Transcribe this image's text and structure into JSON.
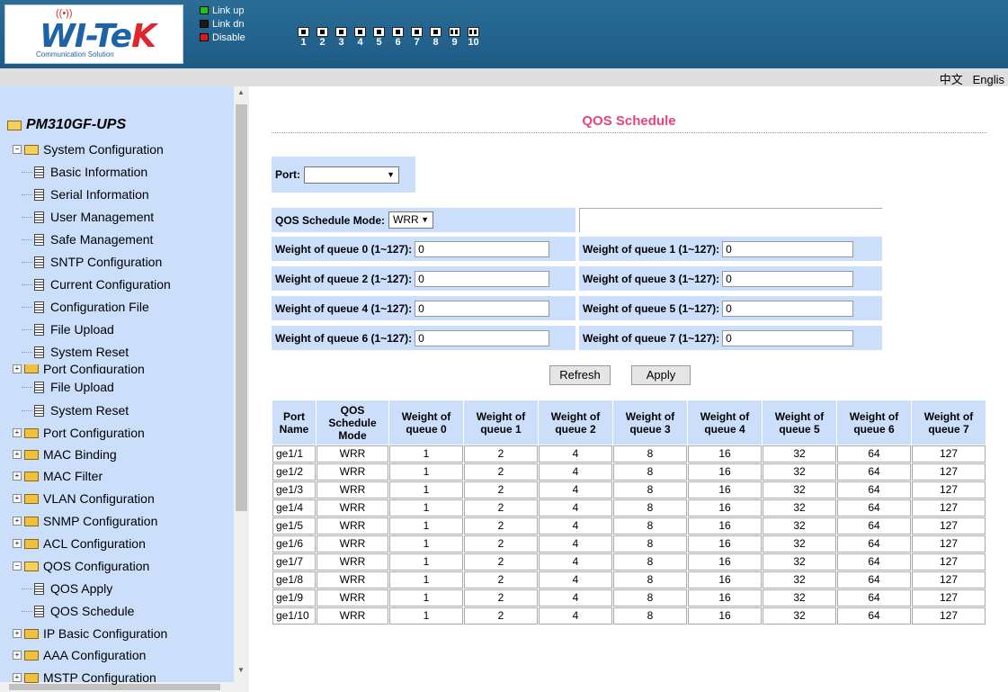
{
  "header": {
    "logo": {
      "wordmark_main": "WI-Te",
      "wordmark_end": "K",
      "slogan": "Communication Solution"
    },
    "legend": [
      {
        "label": "Link up",
        "color": "#19c619"
      },
      {
        "label": "Link dn",
        "color": "#1a1a1a"
      },
      {
        "label": "Disable",
        "color": "#e0141b"
      }
    ],
    "ports": [
      "1",
      "2",
      "3",
      "4",
      "5",
      "6",
      "7",
      "8",
      "9",
      "10"
    ],
    "language": {
      "chinese": "中文",
      "english": "Englis"
    }
  },
  "sidebar": {
    "device": "PM310GF-UPS",
    "items": [
      {
        "label": "System Configuration",
        "kind": "folder-open"
      },
      {
        "label": "Basic Information",
        "kind": "page"
      },
      {
        "label": "Serial Information",
        "kind": "page"
      },
      {
        "label": "User Management",
        "kind": "page"
      },
      {
        "label": "Safe Management",
        "kind": "page"
      },
      {
        "label": "SNTP Configuration",
        "kind": "page"
      },
      {
        "label": "Current Configuration",
        "kind": "page"
      },
      {
        "label": "Configuration File",
        "kind": "page"
      },
      {
        "label": "File Upload",
        "kind": "page"
      },
      {
        "label": "System Reset",
        "kind": "page"
      },
      {
        "label": "Port Configuration",
        "kind": "folder-clipped"
      },
      {
        "label": "File Upload",
        "kind": "page"
      },
      {
        "label": "System Reset",
        "kind": "page"
      },
      {
        "label": "Port Configuration",
        "kind": "folder"
      },
      {
        "label": "MAC Binding",
        "kind": "folder"
      },
      {
        "label": "MAC Filter",
        "kind": "folder"
      },
      {
        "label": "VLAN Configuration",
        "kind": "folder"
      },
      {
        "label": "SNMP Configuration",
        "kind": "folder"
      },
      {
        "label": "ACL Configuration",
        "kind": "folder"
      },
      {
        "label": "QOS Configuration",
        "kind": "folder-open"
      },
      {
        "label": "QOS Apply",
        "kind": "page"
      },
      {
        "label": "QOS Schedule",
        "kind": "page"
      },
      {
        "label": "IP Basic Configuration",
        "kind": "folder"
      },
      {
        "label": "AAA Configuration",
        "kind": "folder"
      },
      {
        "label": "MSTP Configuration",
        "kind": "folder"
      }
    ]
  },
  "main": {
    "title": "QOS Schedule",
    "port_label": "Port:",
    "port_value": "",
    "mode_label": "QOS Schedule Mode:",
    "mode_value": "WRR",
    "weights": [
      {
        "label": "Weight of queue 0 (1~127):",
        "value": "0"
      },
      {
        "label": "Weight of queue 1 (1~127):",
        "value": "0"
      },
      {
        "label": "Weight of queue 2 (1~127):",
        "value": "0"
      },
      {
        "label": "Weight of queue 3 (1~127):",
        "value": "0"
      },
      {
        "label": "Weight of queue 4 (1~127):",
        "value": "0"
      },
      {
        "label": "Weight of queue 5 (1~127):",
        "value": "0"
      },
      {
        "label": "Weight of queue 6 (1~127):",
        "value": "0"
      },
      {
        "label": "Weight of queue 7 (1~127):",
        "value": "0"
      }
    ],
    "refresh_label": "Refresh",
    "apply_label": "Apply"
  },
  "table": {
    "headers": [
      [
        "Port",
        "Name"
      ],
      [
        "QOS",
        "Schedule",
        "Mode"
      ],
      [
        "Weight of",
        "queue 0"
      ],
      [
        "Weight of",
        "queue 1"
      ],
      [
        "Weight of",
        "queue 2"
      ],
      [
        "Weight of",
        "queue 3"
      ],
      [
        "Weight of",
        "queue 4"
      ],
      [
        "Weight of",
        "queue 5"
      ],
      [
        "Weight of",
        "queue 6"
      ],
      [
        "Weight of",
        "queue 7"
      ]
    ],
    "rows": [
      [
        "ge1/1",
        "WRR",
        "1",
        "2",
        "4",
        "8",
        "16",
        "32",
        "64",
        "127"
      ],
      [
        "ge1/2",
        "WRR",
        "1",
        "2",
        "4",
        "8",
        "16",
        "32",
        "64",
        "127"
      ],
      [
        "ge1/3",
        "WRR",
        "1",
        "2",
        "4",
        "8",
        "16",
        "32",
        "64",
        "127"
      ],
      [
        "ge1/4",
        "WRR",
        "1",
        "2",
        "4",
        "8",
        "16",
        "32",
        "64",
        "127"
      ],
      [
        "ge1/5",
        "WRR",
        "1",
        "2",
        "4",
        "8",
        "16",
        "32",
        "64",
        "127"
      ],
      [
        "ge1/6",
        "WRR",
        "1",
        "2",
        "4",
        "8",
        "16",
        "32",
        "64",
        "127"
      ],
      [
        "ge1/7",
        "WRR",
        "1",
        "2",
        "4",
        "8",
        "16",
        "32",
        "64",
        "127"
      ],
      [
        "ge1/8",
        "WRR",
        "1",
        "2",
        "4",
        "8",
        "16",
        "32",
        "64",
        "127"
      ],
      [
        "ge1/9",
        "WRR",
        "1",
        "2",
        "4",
        "8",
        "16",
        "32",
        "64",
        "127"
      ],
      [
        "ge1/10",
        "WRR",
        "1",
        "2",
        "4",
        "8",
        "16",
        "32",
        "64",
        "127"
      ]
    ]
  }
}
